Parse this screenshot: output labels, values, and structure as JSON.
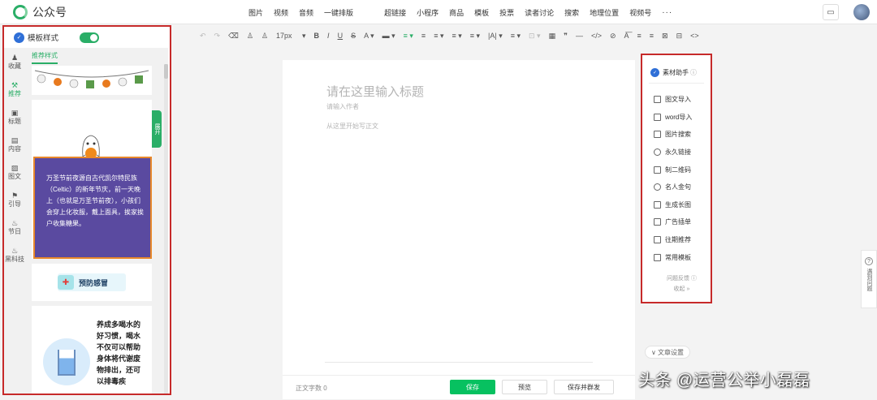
{
  "app": {
    "name": "公众号"
  },
  "insert_menu": [
    "图片",
    "视频",
    "音频",
    "一键排版",
    "超链接",
    "小程序",
    "商品",
    "模板",
    "投票",
    "读者讨论",
    "搜索",
    "地理位置",
    "视频号",
    "···"
  ],
  "template_panel": {
    "title": "模板样式",
    "toggle_on": true,
    "nav": [
      "收藏",
      "推荐",
      "标题",
      "内容",
      "图文",
      "引导",
      "节日",
      "黑科技"
    ],
    "active_nav": "推荐",
    "tab": "推荐样式",
    "expand_label": "展开",
    "halloween_text": "万圣节前夜源自古代凯尔特民族（Celtic）的新年节庆，前一天晚上（也就是万圣节前夜），小孩们会穿上化妆服，戴上面具，挨家挨户收集糖果。",
    "cold_banner": "预防感冒",
    "water_text": "养成多喝水的好习惯，喝水不仅可以帮助身体将代谢废物排出，还可以排毒疾"
  },
  "toolbar": {
    "font_size": "17px",
    "items": [
      "↶",
      "↷",
      "⌫",
      "♙",
      "♙",
      "17px",
      "B",
      "I",
      "U",
      "S",
      "A·",
      "▬·",
      "≡·",
      "≡",
      "≡·",
      "≡·",
      "≡·",
      "|A|·",
      "≡·",
      "⊡·",
      "▦",
      "❞",
      "—",
      "</>",
      "⊘",
      "A͞",
      "≡",
      "≡",
      "⊠",
      "⊟",
      "<>"
    ]
  },
  "editor": {
    "title_placeholder": "请在这里输入标题",
    "author_placeholder": "请输入作者",
    "body_placeholder": "从这里开始写正文"
  },
  "bottom_bar": {
    "word_count_label": "正文字数",
    "word_count": "0",
    "save": "保存",
    "preview": "预览",
    "save_publish": "保存并群发"
  },
  "assistant": {
    "title": "素材助手",
    "items": [
      "图文导入",
      "word导入",
      "图片搜索",
      "永久链接",
      "制二维码",
      "名人金句",
      "生成长图",
      "广告插单",
      "往期推荐",
      "常用模板"
    ],
    "feedback": "问题反馈",
    "collapse": "收起"
  },
  "article_settings": "文章设置",
  "help_tab": "遇到问题",
  "watermark": "头条 @运营公举小磊磊",
  "colors": {
    "accent": "#07c160",
    "highlight_border": "#c62a2a",
    "halloween_bg": "#5a4aa0",
    "halloween_border": "#e8882a"
  }
}
